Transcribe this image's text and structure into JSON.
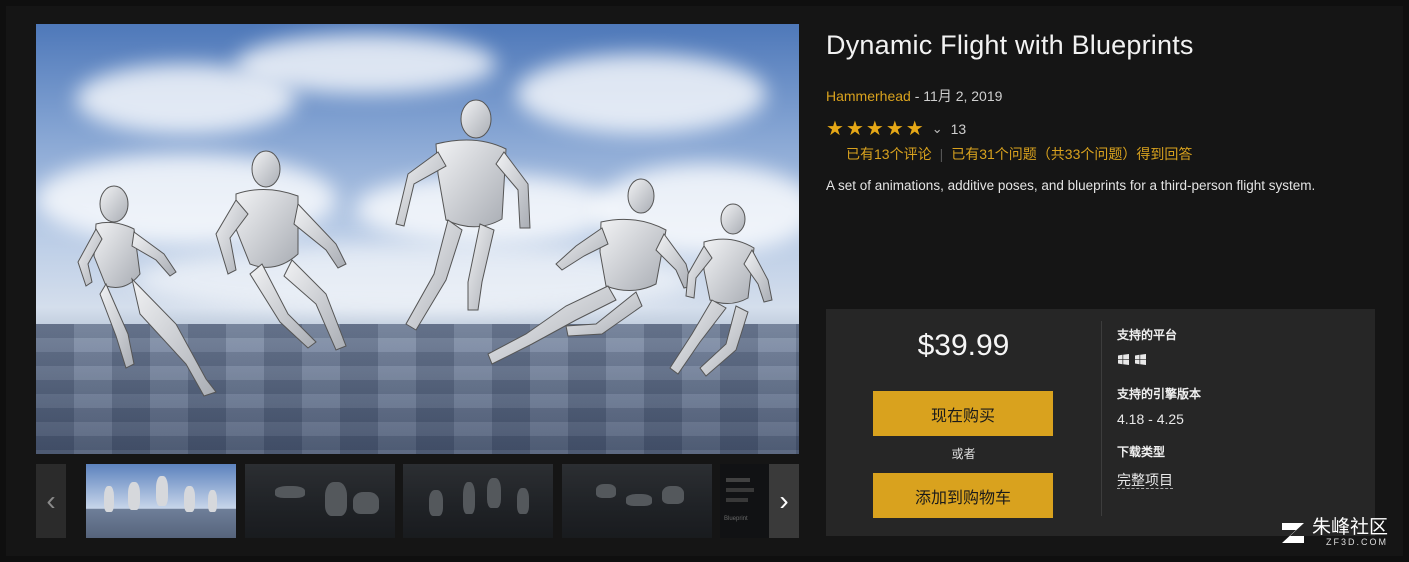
{
  "product": {
    "title": "Dynamic Flight with Blueprints",
    "seller": "Hammerhead",
    "date_sep": " - ",
    "date": "11月 2, 2019",
    "rating_stars": 5,
    "rating_count": "13",
    "reviews_text": "已有13个评论",
    "questions_text": "已有31个问题（共33个问题）得到回答",
    "description": "A set of animations, additive poses, and blueprints for a third-person flight system."
  },
  "purchase": {
    "price": "$39.99",
    "buy_now_label": "现在购买",
    "or_label": "或者",
    "add_to_cart_label": "添加到购物车"
  },
  "specs": {
    "platform_heading": "支持的平台",
    "engine_heading": "支持的引擎版本",
    "engine_versions": "4.18 - 4.25",
    "download_heading": "下载类型",
    "download_type": "完整项目"
  },
  "gallery": {
    "prev_icon": "‹",
    "next_icon": "›",
    "thumbnail_caption": "Blueprint"
  },
  "watermark": {
    "name": "朱峰社区",
    "domain": "ZF3D.COM"
  },
  "colors": {
    "accent": "#d9a21e",
    "background": "#151515",
    "buybox": "#262626"
  }
}
